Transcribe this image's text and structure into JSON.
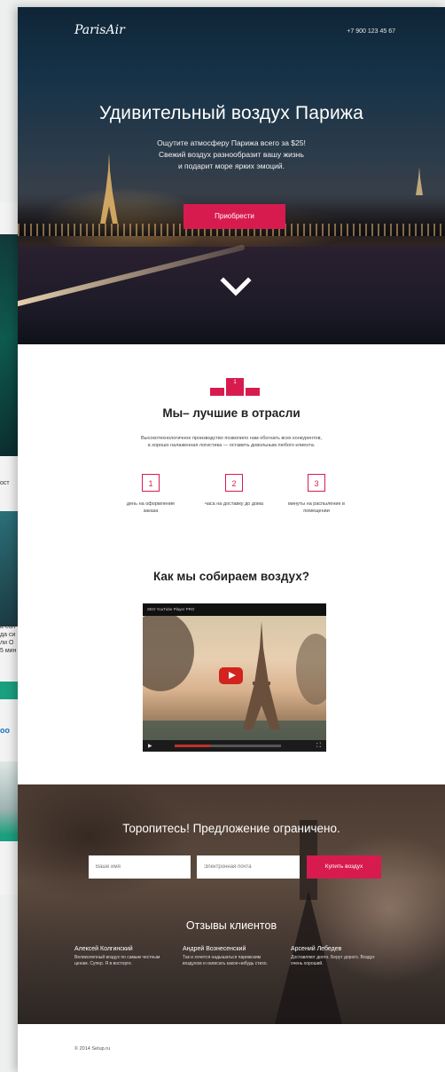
{
  "brand": {
    "logo": "ParisAir",
    "phone": "+7 900 123 45 67"
  },
  "hero": {
    "title": "Удивительный воздух Парижа",
    "subtitle_lines": [
      "Ощутите атмосферу Парижа всего за $25!",
      "Свежий воздух разнообразит вашу жизнь",
      "и подарит море ярких эмоций."
    ],
    "button": "Приобрести"
  },
  "best": {
    "title": "Мы– лучшие в отрасли",
    "podium_number": "1",
    "desc_lines": [
      "Высокотехнологичное производство позволило нам обогнать всех конкурентов,",
      "а хорошо налаженная логистика — оставить довольным любого клиента."
    ],
    "stats": [
      {
        "number": "1",
        "label": "день на оформление заказа"
      },
      {
        "number": "2",
        "label": "часа на доставку до дома"
      },
      {
        "number": "3",
        "label": "минуты на распыление в помещении"
      }
    ]
  },
  "video_section": {
    "title": "Как мы собираем воздух?",
    "video_title": "SEO YouTube Player PRO"
  },
  "cta": {
    "title": "Торопитесь! Предложение ограничено.",
    "name_placeholder": "Ваше имя",
    "email_placeholder": "Электронная почта",
    "button": "Купить воздух"
  },
  "reviews": {
    "title": "Отзывы клиентов",
    "items": [
      {
        "name": "Алексей Колгинский",
        "text": "Великолепный воздух по самым честным ценам. Супер. Я в восторге."
      },
      {
        "name": "Андрей Вознесенский",
        "text": "Так и хочется надышаться парижским воздухом и написать какое-нибудь стихо."
      },
      {
        "name": "Арсений Лебедев",
        "text": "Доставляют долго. Берут дорого. Воздух очень хороший."
      }
    ]
  },
  "footer": {
    "copyright": "© 2014 Setup.ru"
  }
}
